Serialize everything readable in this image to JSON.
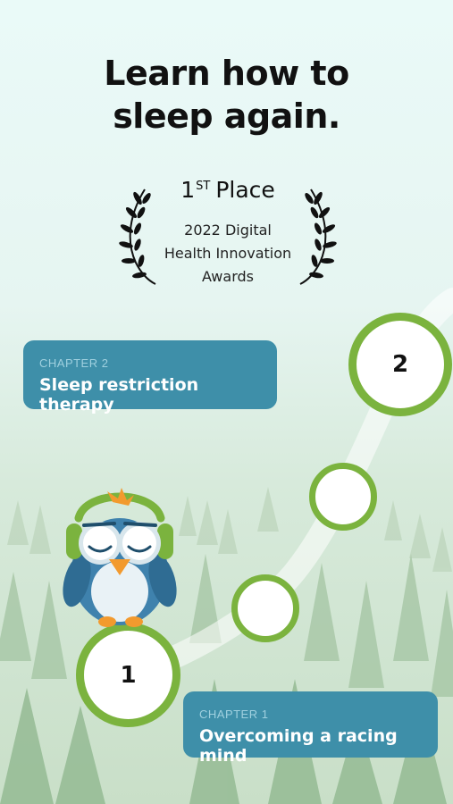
{
  "headline": {
    "line1": "Learn how to",
    "line2": "sleep again."
  },
  "award": {
    "rank": "1",
    "rank_suffix": "ST",
    "place": "Place",
    "line1": "2022 Digital",
    "line2": "Health Innovation",
    "line3": "Awards"
  },
  "chapters": [
    {
      "label": "CHAPTER 1",
      "title": "Overcoming a racing mind",
      "number": "1"
    },
    {
      "label": "CHAPTER 2",
      "title": "Sleep restriction therapy",
      "number": "2"
    }
  ],
  "colors": {
    "card": "#3e8fa9",
    "ring": "#7bb33e",
    "text": "#111111",
    "background_top": "#eafaf8",
    "background_bottom": "#c9dfc8"
  },
  "icons": [
    "laurel-left-icon",
    "laurel-right-icon",
    "owl-mascot-icon"
  ]
}
